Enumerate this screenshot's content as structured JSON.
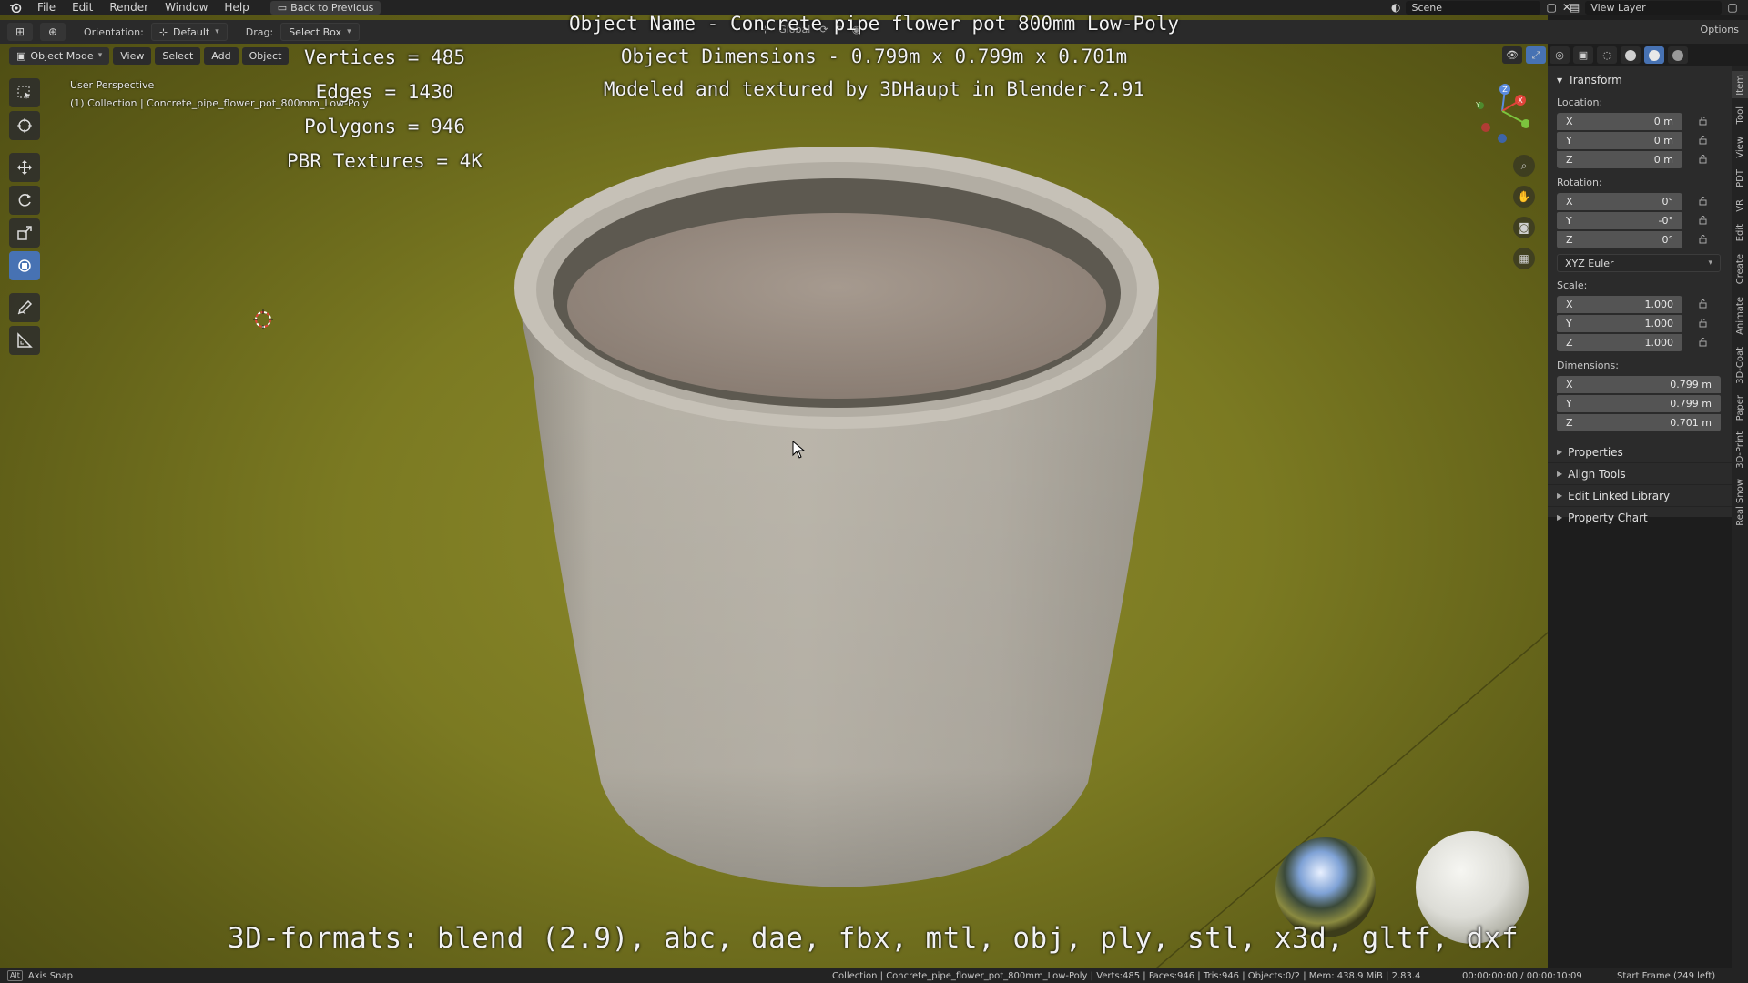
{
  "app": {
    "menu": [
      "File",
      "Edit",
      "Render",
      "Window",
      "Help"
    ],
    "back_button": "Back to Previous",
    "scene": "Scene",
    "view_layer": "View Layer"
  },
  "toolheader": {
    "orientation_label": "Orientation:",
    "orientation_value": "Default",
    "drag_label": "Drag:",
    "drag_value": "Select Box",
    "transform_orientation": "Global",
    "options": "Options"
  },
  "viewport_header": {
    "mode": "Object Mode",
    "menus": [
      "View",
      "Select",
      "Add",
      "Object"
    ]
  },
  "viewport": {
    "perspective": "User Perspective",
    "collection_line": "(1) Collection | Concrete_pipe_flower_pot_800mm_Low-Poly"
  },
  "overlay": {
    "stats": [
      "Vertices = 485",
      "Edges = 1430",
      "Polygons = 946",
      "PBR Textures = 4K"
    ],
    "header_lines": [
      "Object Name - Concrete pipe flower pot 800mm Low-Poly",
      "Object Dimensions -  0.799m x 0.799m x 0.701m",
      "Modeled and textured by 3DHaupt in Blender-2.91"
    ],
    "formats": "3D-formats: blend (2.9), abc, dae, fbx, mtl, obj, ply, stl, x3d, gltf, dxf"
  },
  "npanel": {
    "title": "Transform",
    "location_label": "Location:",
    "location": [
      {
        "axis": "X",
        "value": "0 m"
      },
      {
        "axis": "Y",
        "value": "0 m"
      },
      {
        "axis": "Z",
        "value": "0 m"
      }
    ],
    "rotation_label": "Rotation:",
    "rotation": [
      {
        "axis": "X",
        "value": "0°"
      },
      {
        "axis": "Y",
        "value": "-0°"
      },
      {
        "axis": "Z",
        "value": "0°"
      }
    ],
    "rotation_mode": "XYZ Euler",
    "scale_label": "Scale:",
    "scale": [
      {
        "axis": "X",
        "value": "1.000"
      },
      {
        "axis": "Y",
        "value": "1.000"
      },
      {
        "axis": "Z",
        "value": "1.000"
      }
    ],
    "dimensions_label": "Dimensions:",
    "dimensions": [
      {
        "axis": "X",
        "value": "0.799 m"
      },
      {
        "axis": "Y",
        "value": "0.799 m"
      },
      {
        "axis": "Z",
        "value": "0.701 m"
      }
    ],
    "collapsed_panels": [
      "Properties",
      "Align Tools",
      "Edit Linked Library",
      "Property Chart"
    ]
  },
  "sidetabs": [
    "Item",
    "Tool",
    "View",
    "PDT",
    "VR",
    "Edit",
    "Create",
    "Animate",
    "3D-Coat",
    "Paper",
    "3D-Print",
    "Real Snow"
  ],
  "statusbar": {
    "key": "Alt",
    "hint": "Axis Snap",
    "info": "Collection | Concrete_pipe_flower_pot_800mm_Low-Poly | Verts:485 | Faces:946 | Tris:946 | Objects:0/2 | Mem: 438.9 MiB | 2.83.4",
    "time": "00:00:00:00 / 00:00:10:09",
    "frame": "Start Frame (249 left)"
  },
  "colors": {
    "accent": "#4772b3",
    "viewport_bg": "#7b7a22",
    "panel_bg": "#2b2b2b"
  }
}
